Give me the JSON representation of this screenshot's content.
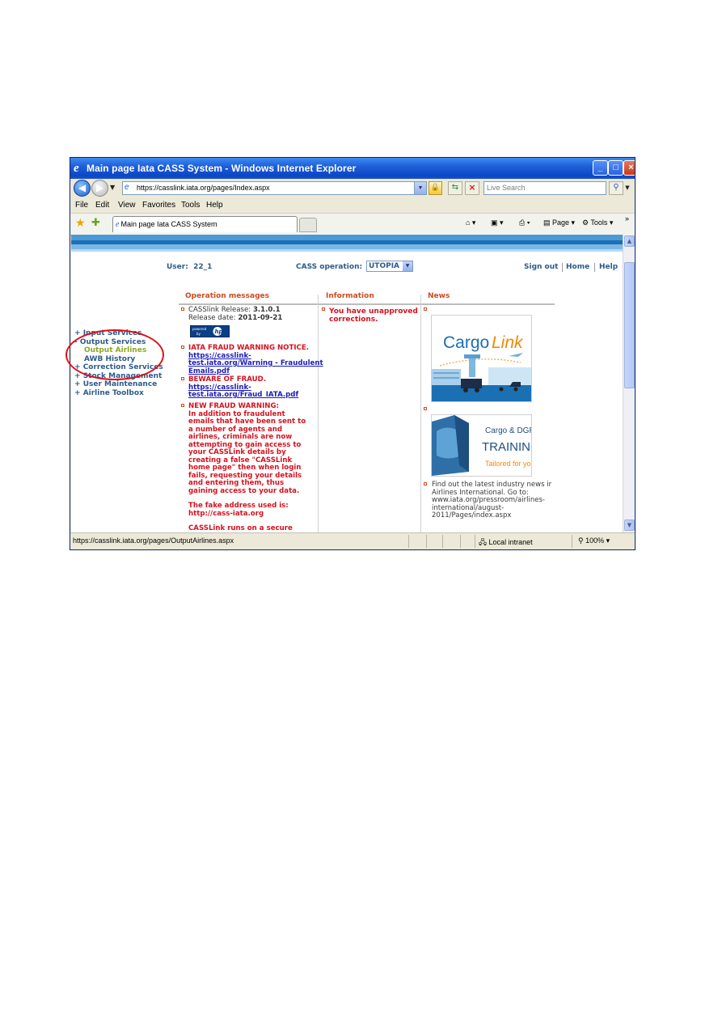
{
  "window": {
    "title": "Main page Iata CASS System - Windows Internet Explorer",
    "url": "https://casslink.iata.org/pages/Index.aspx",
    "search_placeholder": "Live Search"
  },
  "menu": [
    "File",
    "Edit",
    "View",
    "Favorites",
    "Tools",
    "Help"
  ],
  "tab": {
    "label": "Main page Iata CASS System"
  },
  "commandbar": {
    "page": "Page",
    "tools": "Tools"
  },
  "header": {
    "user_label": "User:",
    "user_value": "22_1",
    "cass_label": "CASS operation:",
    "cass_value": "UTOPIA",
    "sign_out": "Sign out",
    "home": "Home",
    "help": "Help"
  },
  "columns": {
    "operation": "Operation messages",
    "information": "Information",
    "news": "News"
  },
  "leftnav": [
    {
      "prefix": "+",
      "label": "Input Services"
    },
    {
      "prefix": "-",
      "label": "Output Services"
    },
    {
      "prefix": "",
      "label": "Output Airlines"
    },
    {
      "prefix": "",
      "label": "AWB History"
    },
    {
      "prefix": "+",
      "label": "Correction Services"
    },
    {
      "prefix": "+",
      "label": "Stock Management"
    },
    {
      "prefix": "+",
      "label": "User Maintenance"
    },
    {
      "prefix": "+",
      "label": "Airline Toolbox"
    }
  ],
  "operation_messages": {
    "release_label": "CASSlink Release:",
    "release_value": "3.1.0.1",
    "date_label": "Release date:",
    "date_value": "2011-09-21",
    "powered": "powered by",
    "notice1_title": "IATA FRAUD WARNING NOTICE.",
    "notice1_link_l1": "https://casslink-",
    "notice1_link_l2": "test.iata.org/Warning - Fraudulent",
    "notice1_link_l3": "Emails.pdf",
    "notice2_title": "BEWARE OF FRAUD.",
    "notice2_link_l1": "https://casslink-",
    "notice2_link_l2": "test.iata.org/Fraud_IATA.pdf",
    "notice3_lines": [
      "NEW FRAUD WARNING:",
      "In addition to fraudulent",
      "emails that have been sent to",
      "a number of agents and",
      "airlines, criminals are now",
      "attempting to gain access to",
      "your CASSLink details by",
      "creating a false \"CASSLink",
      "home page\" then when login",
      "fails, requesting your details",
      "and entering them, thus",
      "gaining access to your data."
    ],
    "fake_l1": "The fake address used is:",
    "fake_l2": "http://cass-iata.org",
    "secure": "CASSLink runs on a secure"
  },
  "information": {
    "line1": "You have unapproved",
    "line2": "corrections."
  },
  "news": {
    "cargo_logo_a": "Cargo",
    "cargo_logo_b": "Link",
    "dgr_l1": "Cargo & DGR",
    "dgr_l2": "TRAINING",
    "dgr_l3": "Tailored for you",
    "item_lines": [
      "Find out the latest industry news ir",
      "Airlines International. Go to:",
      "www.iata.org/pressroom/airlines-",
      "international/august-",
      "2011/Pages/index.aspx"
    ]
  },
  "statusbar": {
    "url": "https://casslink.iata.org/pages/OutputAirlines.aspx",
    "zone": "Local intranet",
    "zoom": "100%"
  },
  "colors": {
    "accent_red": "#d4121f",
    "nav_blue": "#2d5b8c",
    "highlight_ring": "#e0101a"
  }
}
